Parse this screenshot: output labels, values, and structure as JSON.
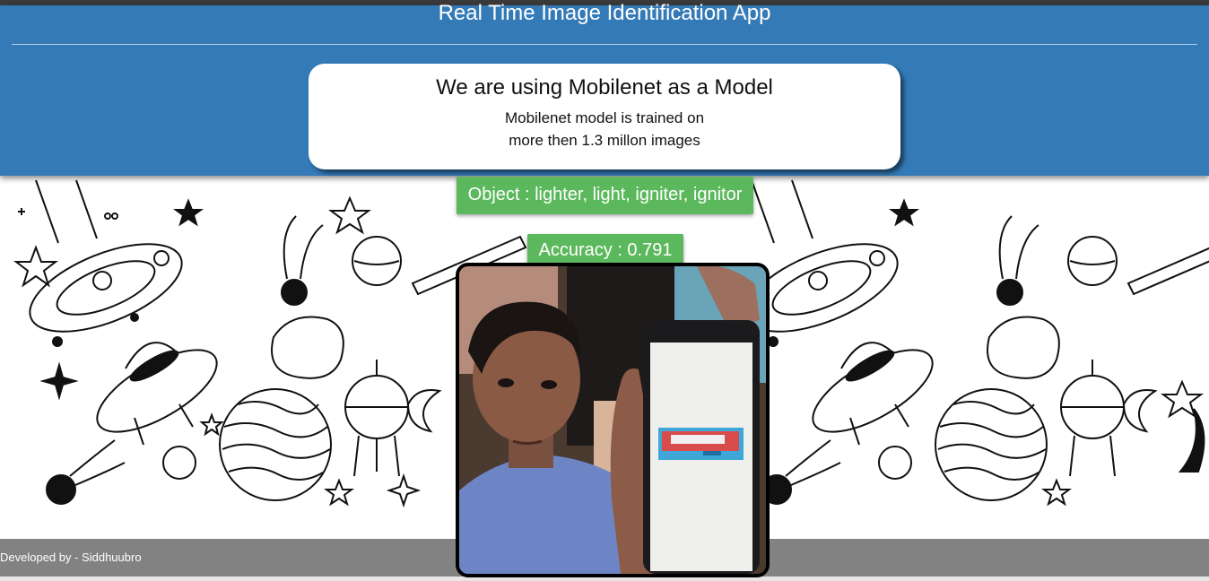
{
  "header": {
    "title": "Real Time Image Identification App",
    "card_title": "We are using Mobilenet as a Model",
    "card_line1": "Mobilenet model is trained on",
    "card_line2": "more then 1.3 millon images"
  },
  "prediction": {
    "object_label": "Object : lighter, light, igniter, ignitor",
    "accuracy_label": "Accuracy : 0.791"
  },
  "background": {
    "icon": "space-doodle-pattern"
  },
  "camera": {
    "icon": "webcam-feed"
  },
  "footer": {
    "text": "Developed by - Siddhuubro"
  },
  "colors": {
    "header": "#337ab7",
    "pill": "#5cb85c",
    "footer": "#828282"
  }
}
